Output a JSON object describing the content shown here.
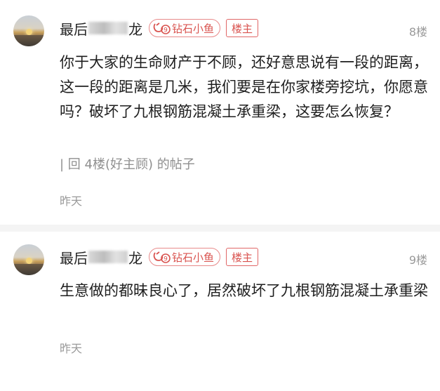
{
  "posts": [
    {
      "username_prefix": "最后",
      "username_suffix": "龙",
      "level_badge": "钻石小鱼",
      "op_tag": "楼主",
      "floor": "8楼",
      "content": "你于大家的生命财产于不顾，还好意思说有一段的距离，这一段的距离是几米，我们要是在你家楼旁挖坑，你愿意吗？破坏了九根钢筋混凝土承重梁，这要怎么恢复？",
      "reply_quote": "| 回 4楼(好主顾) 的帖子",
      "time": "昨天"
    },
    {
      "username_prefix": "最后",
      "username_suffix": "龙",
      "level_badge": "钻石小鱼",
      "op_tag": "楼主",
      "floor": "9楼",
      "content": "生意做的都昧良心了，居然破坏了九根钢筋混凝土承重梁",
      "time": "昨天"
    }
  ],
  "icons": {
    "avatar": "sunset-avatar",
    "badge": "fish-hook-badge-icon"
  },
  "colors": {
    "badge_red": "#d9534f",
    "muted_gray": "#9a9a9a"
  }
}
